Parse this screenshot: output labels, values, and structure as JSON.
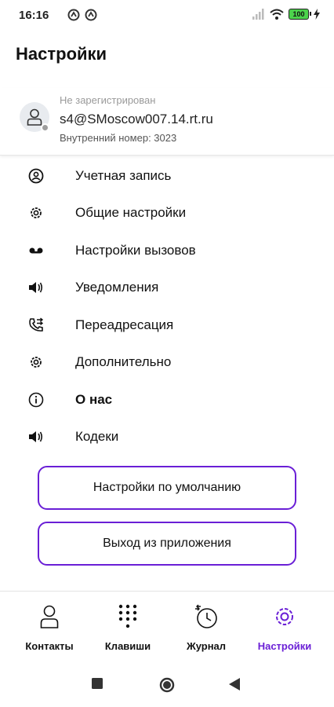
{
  "status_bar": {
    "time": "16:16",
    "battery": "100"
  },
  "page": {
    "title": "Настройки"
  },
  "account": {
    "registration_status": "Не зарегистрирован",
    "address": "s4@SMoscow007.14.rt.ru",
    "internal_number": "Внутренний номер: 3023",
    "presence_color": "#9e9e9e"
  },
  "menu": {
    "items": [
      {
        "label": "Учетная запись",
        "icon": "user-circle-icon"
      },
      {
        "label": "Общие настройки",
        "icon": "gear-icon"
      },
      {
        "label": "Настройки вызовов",
        "icon": "voicemail-icon"
      },
      {
        "label": "Уведомления",
        "icon": "speaker-icon"
      },
      {
        "label": "Переадресация",
        "icon": "call-forward-icon"
      },
      {
        "label": "Дополнительно",
        "icon": "gear-icon"
      },
      {
        "label": "О нас",
        "icon": "info-icon"
      },
      {
        "label": "Кодеки",
        "icon": "speaker-icon"
      }
    ]
  },
  "buttons": {
    "defaults": "Настройки по умолчанию",
    "exit": "Выход из приложения"
  },
  "bottom_nav": {
    "items": [
      {
        "label": "Контакты",
        "icon": "person-icon"
      },
      {
        "label": "Клавиши",
        "icon": "dialpad-icon"
      },
      {
        "label": "Журнал",
        "icon": "history-icon"
      },
      {
        "label": "Настройки",
        "icon": "gear-icon"
      }
    ],
    "active_index": 3
  },
  "colors": {
    "accent": "#6a1fd6",
    "battery_fill": "#4cd34c"
  }
}
